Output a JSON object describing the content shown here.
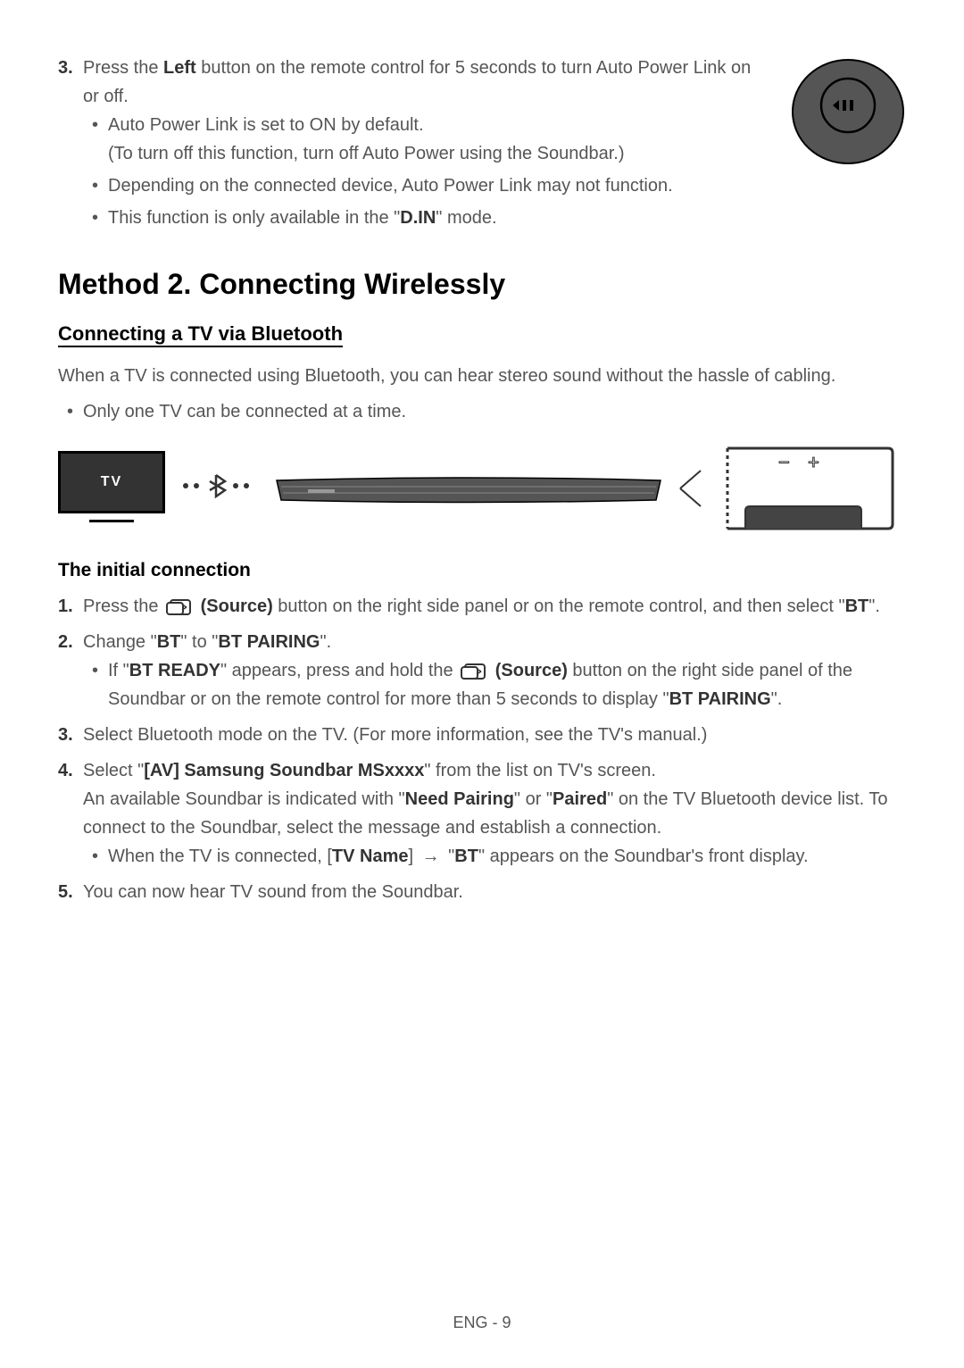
{
  "step3": {
    "num": "3.",
    "text_prefix": "Press the ",
    "text_bold": "Left",
    "text_suffix": " button on the remote control for 5 seconds to turn Auto Power Link on or off.",
    "bullets": [
      {
        "line1": "Auto Power Link is set to ON by default.",
        "line2": "(To turn off this function, turn off Auto Power using the Soundbar.)"
      },
      {
        "text": "Depending on the connected device, Auto Power Link may not function."
      },
      {
        "prefix": "This function is only available in the \"",
        "bold": "D.IN",
        "suffix": "\" mode."
      }
    ]
  },
  "heading2": "Method 2. Connecting Wirelessly",
  "heading3": "Connecting a TV via Bluetooth",
  "intro": "When a TV is connected using Bluetooth, you can hear stereo sound without the hassle of cabling.",
  "intro_bullet": "Only one TV can be connected at a time.",
  "diagram": {
    "tv_label": "TV"
  },
  "heading4": "The initial connection",
  "steps": {
    "step1": {
      "num": "1.",
      "prefix": "Press the ",
      "mid": " (Source)",
      "suffix": " button on the right side panel or on the remote control, and then select \"",
      "bold_end": "BT",
      "end": "\"."
    },
    "step2": {
      "num": "2.",
      "prefix": "Change \"",
      "bold1": "BT",
      "mid": "\" to \"",
      "bold2": "BT PAIRING",
      "suffix": "\".",
      "bullet": {
        "prefix": "If \"",
        "bold1": "BT READY",
        "mid1": "\" appears, press and hold the ",
        "source": " (Source)",
        "mid2": " button on the right side panel of the Soundbar or on the remote control for more than 5 seconds to display \"",
        "bold2": "BT PAIRING",
        "suffix": "\"."
      }
    },
    "step3b": {
      "num": "3.",
      "text": "Select Bluetooth mode on the TV. (For more information, see the TV's manual.)"
    },
    "step4": {
      "num": "4.",
      "prefix": "Select \"",
      "bold1": "[AV] Samsung Soundbar MSxxxx",
      "suffix1": "\" from the list on TV's screen.",
      "line2_prefix": "An available Soundbar is indicated with \"",
      "line2_bold1": "Need Pairing",
      "line2_mid": "\" or \"",
      "line2_bold2": "Paired",
      "line2_suffix": "\" on the TV Bluetooth device list. To connect to the Soundbar, select the message and establish a connection.",
      "bullet": {
        "prefix": "When the TV is connected, [",
        "bold1": "TV Name",
        "mid": "] ",
        "arrow": "→",
        "mid2": " \"",
        "bold2": "BT",
        "suffix": "\" appears on the Soundbar's front display."
      }
    },
    "step5": {
      "num": "5.",
      "text": "You can now hear TV sound from the Soundbar."
    }
  },
  "footer": "ENG - 9"
}
